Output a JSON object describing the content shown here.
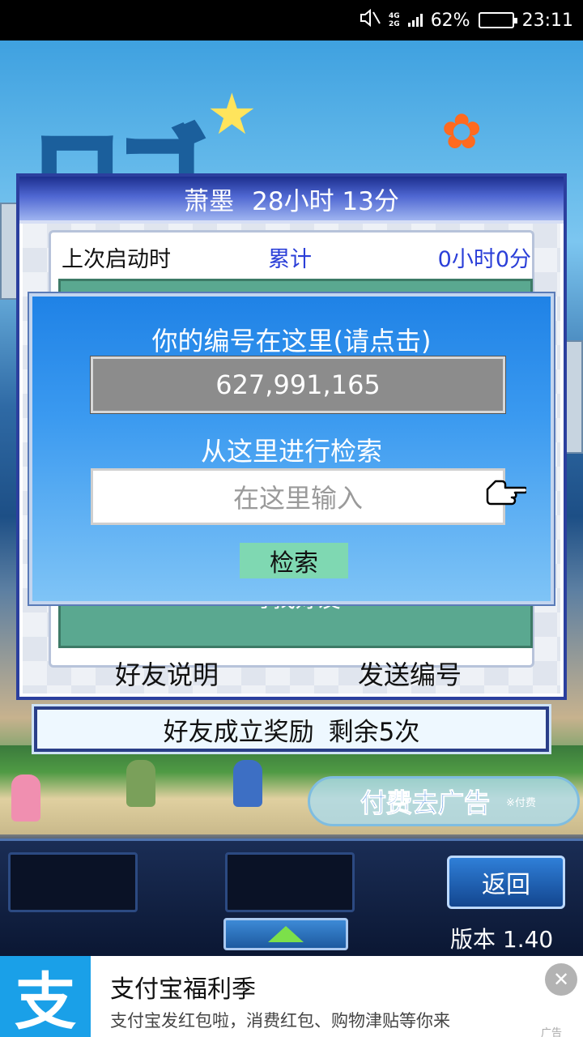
{
  "status_bar": {
    "network_top": "4G",
    "network_bottom": "2G",
    "battery": "62%",
    "battery_level": 0.62,
    "time": "23:11"
  },
  "friend_panel": {
    "header_name": "萧墨",
    "header_time": "28小时 13分",
    "last_launch_label": "上次启动时",
    "cumulative_label": "累计",
    "cumulative_value": "0小时0分",
    "find_friend_label": "寻找好友",
    "friend_help_button": "好友说明",
    "send_id_button": "发送编号"
  },
  "reward_bar": {
    "label": "好友成立奖励",
    "remaining": "剩余5次"
  },
  "search_dialog": {
    "title": "你的编号在这里(请点击)",
    "user_id": "627,991,165",
    "search_prompt": "从这里进行检索",
    "input_placeholder": "在这里输入",
    "search_button": "检索"
  },
  "game_ui": {
    "remove_ads_label": "付费去广告",
    "remove_ads_note": "※付费",
    "back_button": "返回",
    "version": "版本 1.40"
  },
  "ad_banner": {
    "logo_char": "支",
    "title": "支付宝福利季",
    "description": "支付宝发红包啦，消费红包、购物津贴等你来",
    "tag": "广告"
  },
  "colors": {
    "dialog_blue": "#1f82e6",
    "panel_header": "#1c2f8e",
    "search_button": "#7fd8b2",
    "alipay_blue": "#1aa0e8"
  }
}
